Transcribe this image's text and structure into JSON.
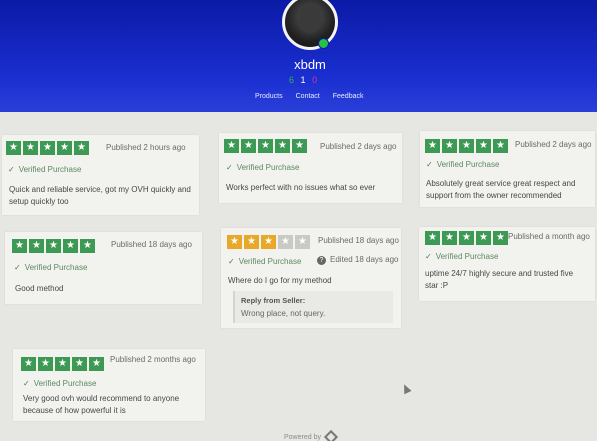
{
  "header": {
    "username": "xbdm",
    "stats": {
      "positive": "6",
      "neutral": "1",
      "negative": "0"
    },
    "nav": [
      "Products",
      "Contact",
      "Feedback"
    ],
    "colors": {
      "header": "#0b1aa6",
      "online": "#25c244",
      "star": "#3c9a54"
    }
  },
  "reviews": [
    {
      "stars": 5,
      "published": "Published 2 hours ago",
      "verified": "Verified Purchase",
      "text": "Quick and reliable service, got my OVH quickly and setup quickly too"
    },
    {
      "stars": 5,
      "published": "Published 2 days ago",
      "verified": "Verified Purchase",
      "text": "Works perfect with no issues what so ever"
    },
    {
      "stars": 5,
      "published": "Published 2 days ago",
      "verified": "Verified Purchase",
      "text": "Absolutely great service great respect and support from the owner recommended"
    },
    {
      "stars": 5,
      "published": "Published 18 days ago",
      "verified": "Verified Purchase",
      "text": "Good method"
    },
    {
      "stars": 3,
      "published": "Published 18 days ago",
      "verified": "Verified Purchase",
      "edited": "Edited 18 days ago",
      "text": "Where do I go for my method",
      "reply_title": "Reply from Seller:",
      "reply_text": "Wrong place, not query."
    },
    {
      "stars": 5,
      "published": "Published a month ago",
      "verified": "Verified Purchase",
      "text": "uptime 24/7 highly secure and trusted five star :P"
    },
    {
      "stars": 5,
      "published": "Published 2 months ago",
      "verified": "Verified Purchase",
      "text": "Very good ovh would recommend to anyone because of how powerful it is"
    }
  ],
  "footer": {
    "powered_by": "Powered by"
  }
}
